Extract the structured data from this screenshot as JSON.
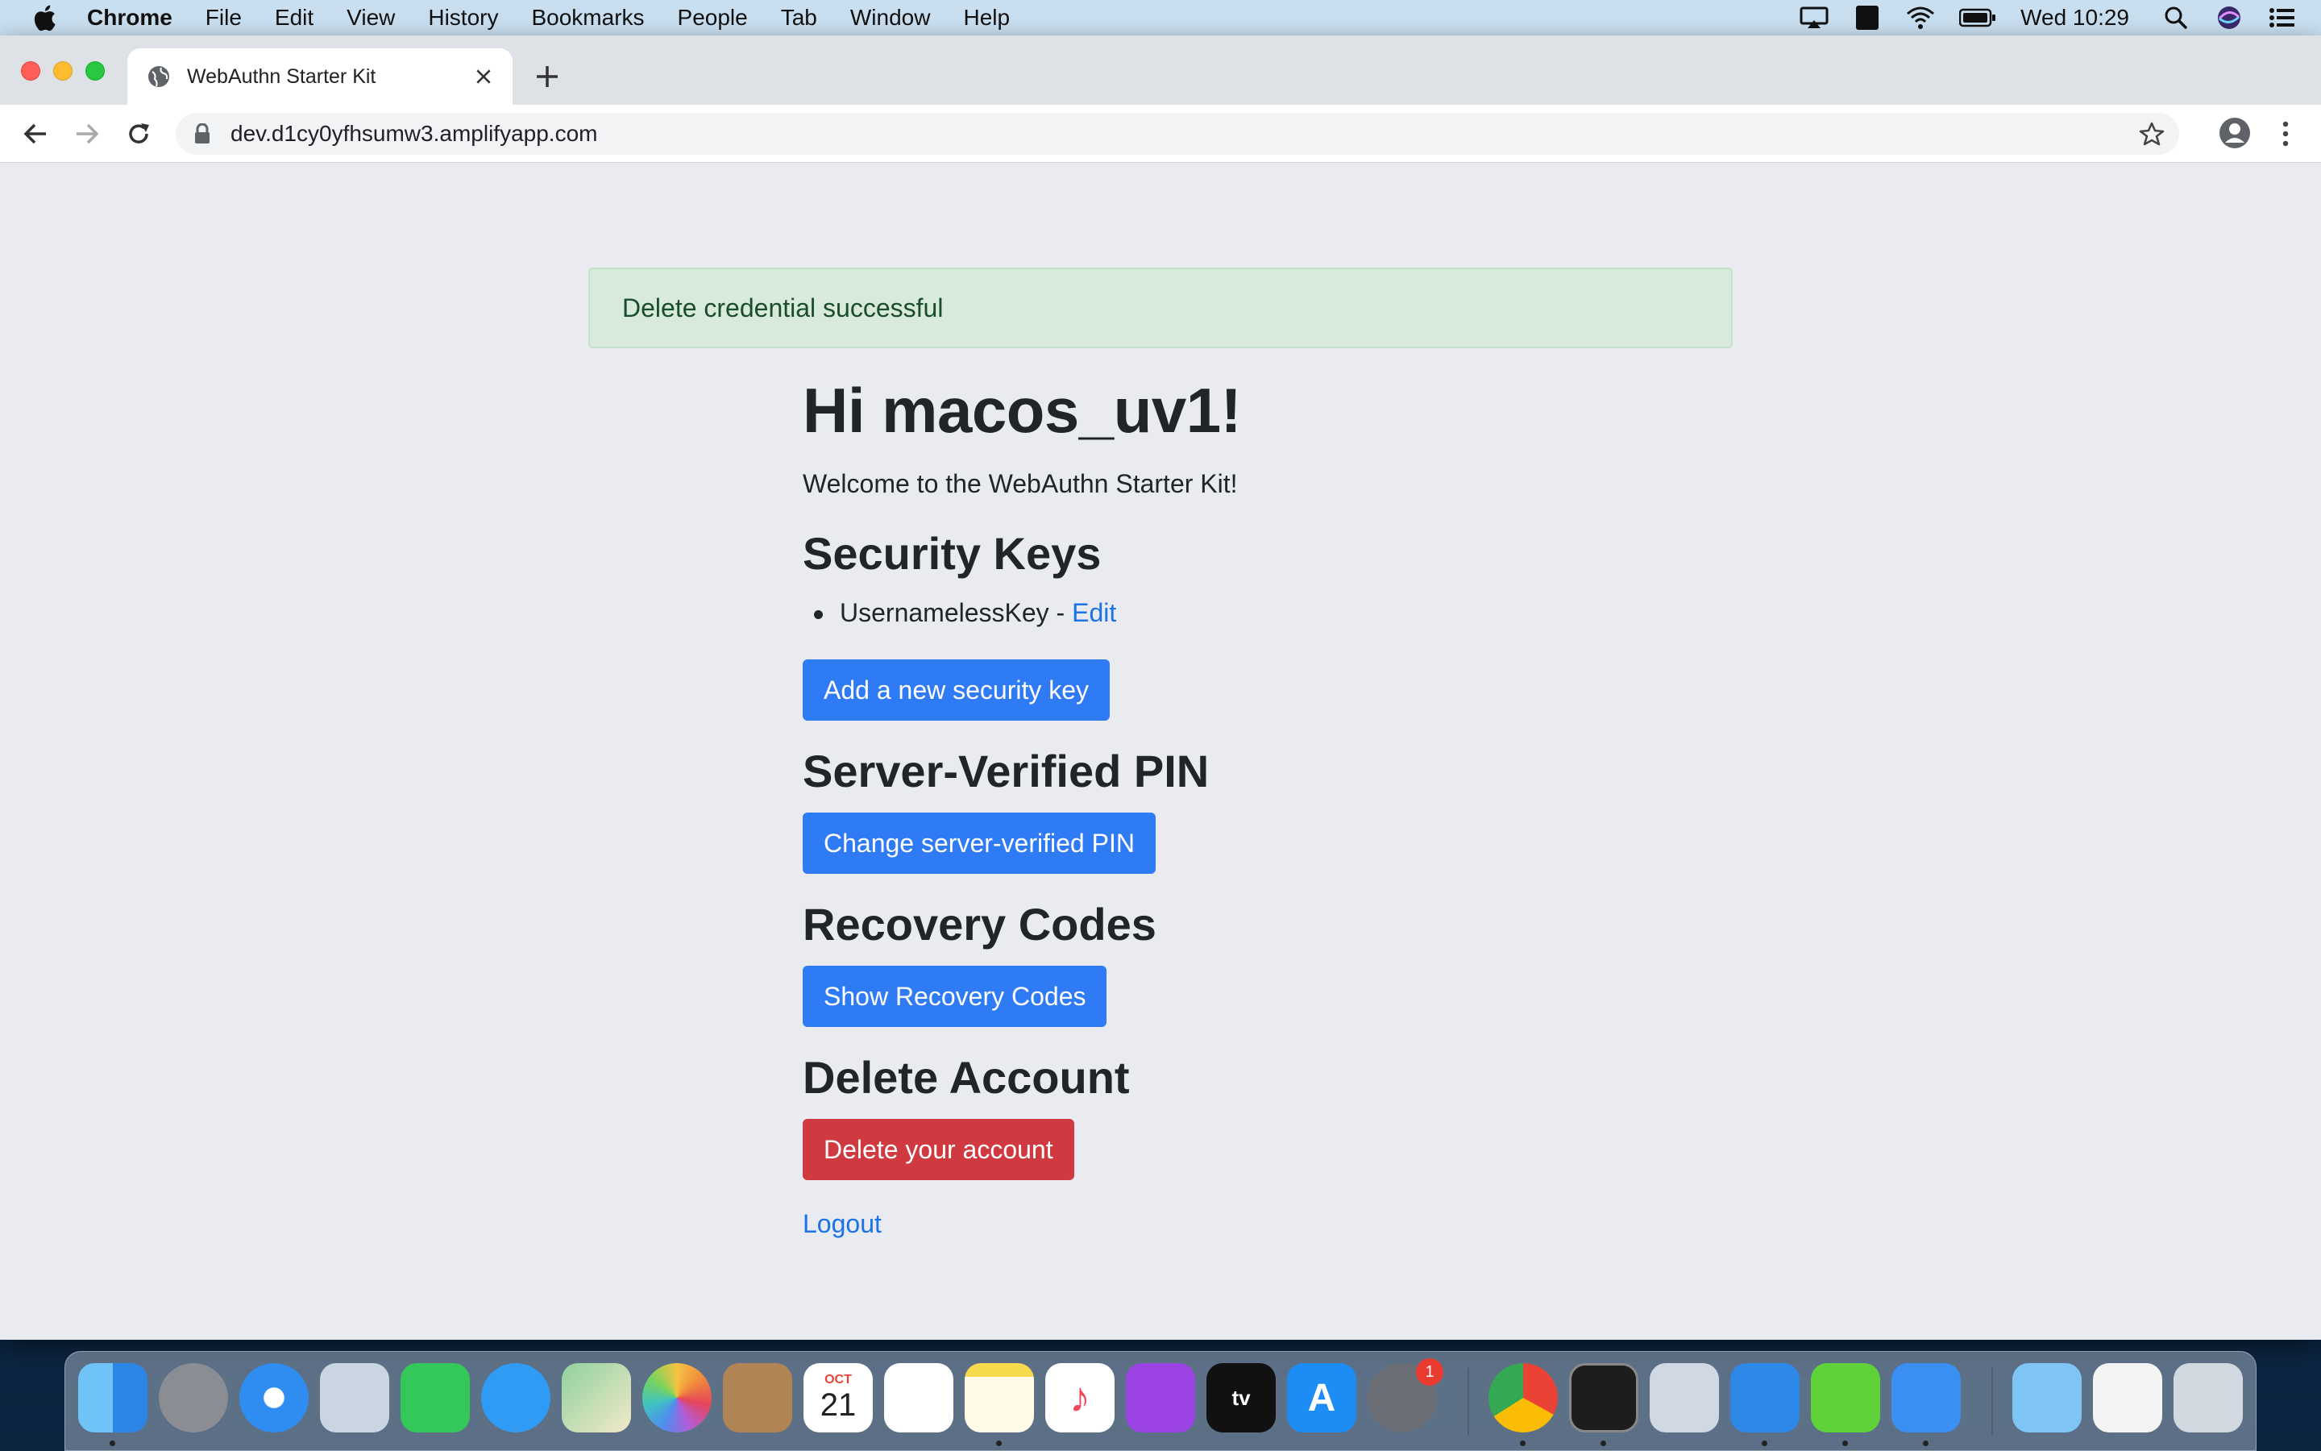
{
  "menubar": {
    "app_name": "Chrome",
    "items": [
      "File",
      "Edit",
      "View",
      "History",
      "Bookmarks",
      "People",
      "Tab",
      "Window",
      "Help"
    ],
    "clock": "Wed 10:29",
    "input_source": "A"
  },
  "browser": {
    "tab_title": "WebAuthn Starter Kit",
    "url": "dev.d1cy0yfhsumw3.amplifyapp.com"
  },
  "page": {
    "alert": "Delete credential successful",
    "greeting": "Hi macos_uv1!",
    "welcome": "Welcome to the WebAuthn Starter Kit!",
    "security_keys": {
      "heading": "Security Keys",
      "keys": [
        {
          "name": "UsernamelessKey",
          "separator": " - ",
          "edit_label": "Edit"
        }
      ],
      "add_button": "Add a new security key"
    },
    "pin": {
      "heading": "Server-Verified PIN",
      "button": "Change server-verified PIN"
    },
    "recovery": {
      "heading": "Recovery Codes",
      "button": "Show Recovery Codes"
    },
    "delete_account": {
      "heading": "Delete Account",
      "button": "Delete your account"
    },
    "logout": "Logout"
  },
  "colors": {
    "primary_button": "#2f7bf5",
    "danger_button": "#d0393f",
    "link": "#1a73e8",
    "alert_bg": "#d8eadc"
  },
  "dock": {
    "calendar_month": "OCT",
    "calendar_day": "21",
    "system_prefs_badge": "1",
    "tv_label": "tv"
  }
}
